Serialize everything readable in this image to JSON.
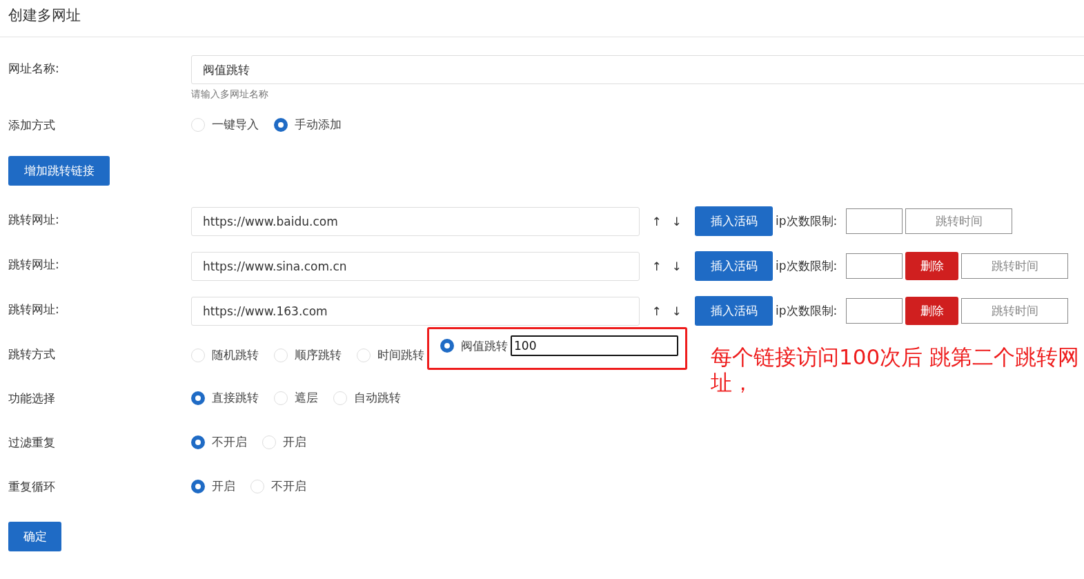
{
  "title": "创建多网址",
  "name_field": {
    "label": "网址名称:",
    "value": "阀值跳转",
    "hint": "请输入多网址名称"
  },
  "add_method": {
    "label": "添加方式",
    "options": [
      {
        "label": "一键导入",
        "selected": false
      },
      {
        "label": "手动添加",
        "selected": true
      }
    ]
  },
  "add_link_button": "增加跳转链接",
  "links": [
    {
      "label": "跳转网址:",
      "value": "https://www.baidu.com",
      "up": "↑",
      "down": "↓",
      "insert_button": "插入活码",
      "ip_label": "ip次数限制:",
      "time_button": "跳转时间"
    },
    {
      "label": "跳转网址:",
      "value": "https://www.sina.com.cn",
      "up": "↑",
      "down": "↓",
      "insert_button": "插入活码",
      "ip_label": "ip次数限制:",
      "delete_button": "删除",
      "time_button": "跳转时间"
    },
    {
      "label": "跳转网址:",
      "value": "https://www.163.com",
      "up": "↑",
      "down": "↓",
      "insert_button": "插入活码",
      "ip_label": "ip次数限制:",
      "delete_button": "删除",
      "time_button": "跳转时间"
    }
  ],
  "jump_method": {
    "label": "跳转方式",
    "options": [
      {
        "kind": "plain",
        "label": "随机跳转",
        "selected": false
      },
      {
        "kind": "plain",
        "label": "顺序跳转",
        "selected": false
      },
      {
        "kind": "plain",
        "label": "时间跳转",
        "selected": false
      },
      {
        "kind": "threshold",
        "label": "阀值跳转",
        "selected": true,
        "value": "100"
      }
    ]
  },
  "radio_groups": [
    {
      "label": "功能选择",
      "options": [
        {
          "label": "直接跳转",
          "selected": true
        },
        {
          "label": "遮层",
          "selected": false
        },
        {
          "label": "自动跳转",
          "selected": false
        }
      ]
    },
    {
      "label": "过滤重复",
      "options": [
        {
          "label": "不开启",
          "selected": true
        },
        {
          "label": "开启",
          "selected": false
        }
      ]
    },
    {
      "label": "重复循环",
      "options": [
        {
          "label": "开启",
          "selected": true
        },
        {
          "label": "不开启",
          "selected": false
        }
      ]
    }
  ],
  "annotation": "每个链接访问100次后 跳第二个跳转网址，",
  "confirm_button": "确定"
}
